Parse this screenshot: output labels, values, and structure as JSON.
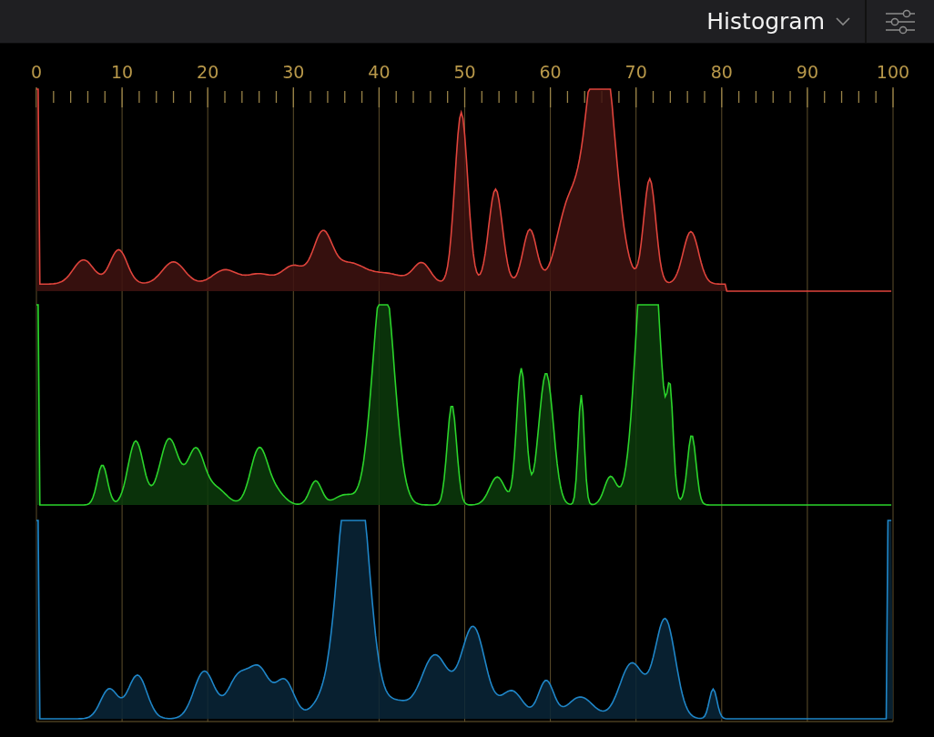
{
  "panel": {
    "title": "Histogram"
  },
  "scale": {
    "labels": [
      "0",
      "10",
      "20",
      "30",
      "40",
      "50",
      "60",
      "70",
      "80",
      "90",
      "100"
    ]
  },
  "channels": [
    {
      "kind": "red",
      "color": "#e0443c"
    },
    {
      "kind": "green",
      "color": "#2bd42b"
    },
    {
      "kind": "blue",
      "color": "#1f86c8"
    }
  ]
}
